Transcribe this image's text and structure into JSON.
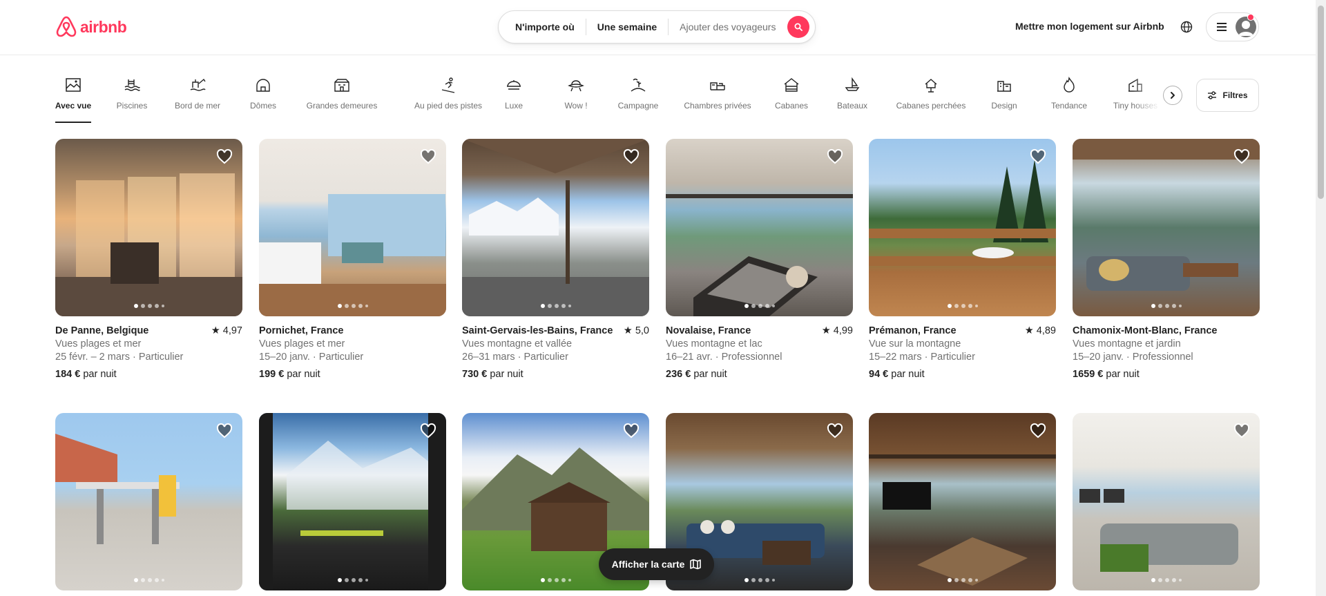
{
  "brand": {
    "name": "airbnb",
    "color": "#FF385C"
  },
  "search": {
    "where": "N'importe où",
    "when": "Une semaine",
    "who": "Ajouter des voyageurs",
    "icon": "search-icon"
  },
  "header": {
    "host_link": "Mettre mon logement sur Airbnb",
    "globe_icon": "globe-icon",
    "menu_icon": "hamburger-menu-icon"
  },
  "categories": [
    {
      "label": "Avec vue",
      "icon": "view-icon",
      "active": true
    },
    {
      "label": "Piscines",
      "icon": "pool-icon"
    },
    {
      "label": "Bord de mer",
      "icon": "beachfront-icon"
    },
    {
      "label": "Dômes",
      "icon": "dome-icon"
    },
    {
      "label": "Grandes demeures",
      "icon": "mansion-icon"
    },
    {
      "label": "Au pied des pistes",
      "icon": "ski-icon"
    },
    {
      "label": "Luxe",
      "icon": "luxe-icon"
    },
    {
      "label": "Wow !",
      "icon": "ufo-icon"
    },
    {
      "label": "Campagne",
      "icon": "countryside-icon"
    },
    {
      "label": "Chambres privées",
      "icon": "private-room-icon"
    },
    {
      "label": "Cabanes",
      "icon": "cabin-icon"
    },
    {
      "label": "Bateaux",
      "icon": "boat-icon"
    },
    {
      "label": "Cabanes perchées",
      "icon": "treehouse-icon"
    },
    {
      "label": "Design",
      "icon": "design-icon"
    },
    {
      "label": "Tendance",
      "icon": "flame-icon"
    },
    {
      "label": "Tiny houses",
      "icon": "tiny-house-icon"
    }
  ],
  "filters_label": "Filtres",
  "listings": [
    {
      "location": "De Panne, Belgique",
      "rating": "4,97",
      "subtitle": "Vues plages et mer",
      "dates": "25 févr. – 2 mars · Particulier",
      "price": "184 €",
      "price_suffix": "par nuit"
    },
    {
      "location": "Pornichet, France",
      "rating": "",
      "subtitle": "Vues plages et mer",
      "dates": "15–20 janv. · Particulier",
      "price": "199 €",
      "price_suffix": "par nuit"
    },
    {
      "location": "Saint-Gervais-les-Bains, France",
      "rating": "5,0",
      "subtitle": "Vues montagne et vallée",
      "dates": "26–31 mars · Particulier",
      "price": "730 €",
      "price_suffix": "par nuit"
    },
    {
      "location": "Novalaise, France",
      "rating": "4,99",
      "subtitle": "Vues montagne et lac",
      "dates": "16–21 avr. · Professionnel",
      "price": "236 €",
      "price_suffix": "par nuit"
    },
    {
      "location": "Prémanon, France",
      "rating": "4,89",
      "subtitle": "Vue sur la montagne",
      "dates": "15–22 mars · Particulier",
      "price": "94 €",
      "price_suffix": "par nuit"
    },
    {
      "location": "Chamonix-Mont-Blanc, France",
      "rating": "",
      "subtitle": "Vues montagne et jardin",
      "dates": "15–20 janv. · Professionnel",
      "price": "1659 €",
      "price_suffix": "par nuit"
    }
  ],
  "map_button": "Afficher la carte",
  "colors": {
    "accent": "#FF385C",
    "text": "#222222",
    "muted": "#717171"
  }
}
